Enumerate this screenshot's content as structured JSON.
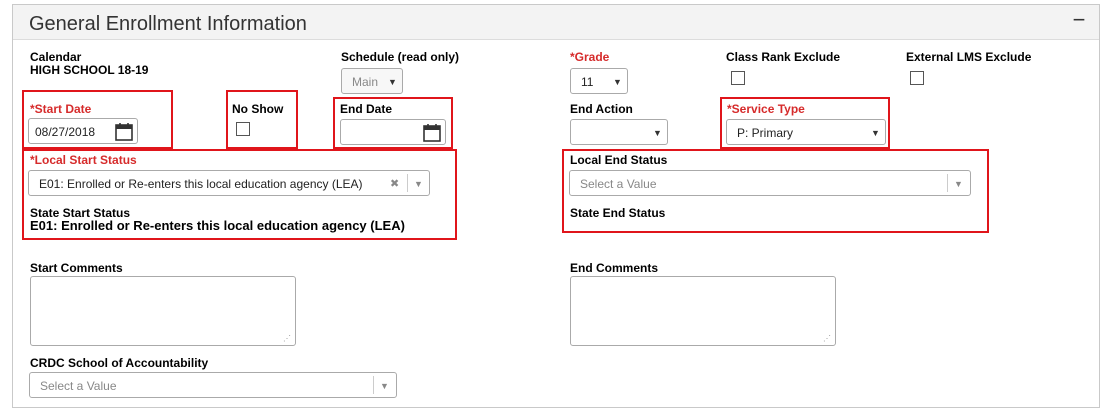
{
  "header": {
    "title": "General Enrollment Information",
    "collapse_symbol": "−"
  },
  "calendar": {
    "label": "Calendar",
    "value": "HIGH SCHOOL 18-19"
  },
  "schedule": {
    "label": "Schedule (read only)",
    "value": "Main"
  },
  "grade": {
    "label": "*Grade",
    "value": "11"
  },
  "class_rank_exclude": {
    "label": "Class Rank Exclude",
    "checked": false
  },
  "external_lms_exclude": {
    "label": "External LMS Exclude",
    "checked": false
  },
  "start_date": {
    "label": "*Start Date",
    "value": "08/27/2018"
  },
  "no_show": {
    "label": "No Show",
    "checked": false
  },
  "end_date": {
    "label": "End Date",
    "value": ""
  },
  "end_action": {
    "label": "End Action",
    "value": ""
  },
  "service_type": {
    "label": "*Service Type",
    "value": "P: Primary"
  },
  "local_start_status": {
    "label": "*Local Start Status",
    "value": "E01: Enrolled or Re-enters this local education agency (LEA)",
    "clear_symbol": "✖"
  },
  "state_start_status": {
    "label": "State Start Status",
    "value": "E01: Enrolled or Re-enters this local education agency (LEA)"
  },
  "local_end_status": {
    "label": "Local End Status",
    "placeholder": "Select a Value"
  },
  "state_end_status": {
    "label": "State End Status"
  },
  "start_comments": {
    "label": "Start Comments"
  },
  "end_comments": {
    "label": "End Comments"
  },
  "crdc": {
    "label": "CRDC School of Accountability",
    "placeholder": "Select a Value"
  },
  "icons": {
    "dropdown": "▼",
    "resize_grip": "⋰"
  },
  "colors": {
    "required": "#d62b2b",
    "highlight": "#e0151b"
  }
}
